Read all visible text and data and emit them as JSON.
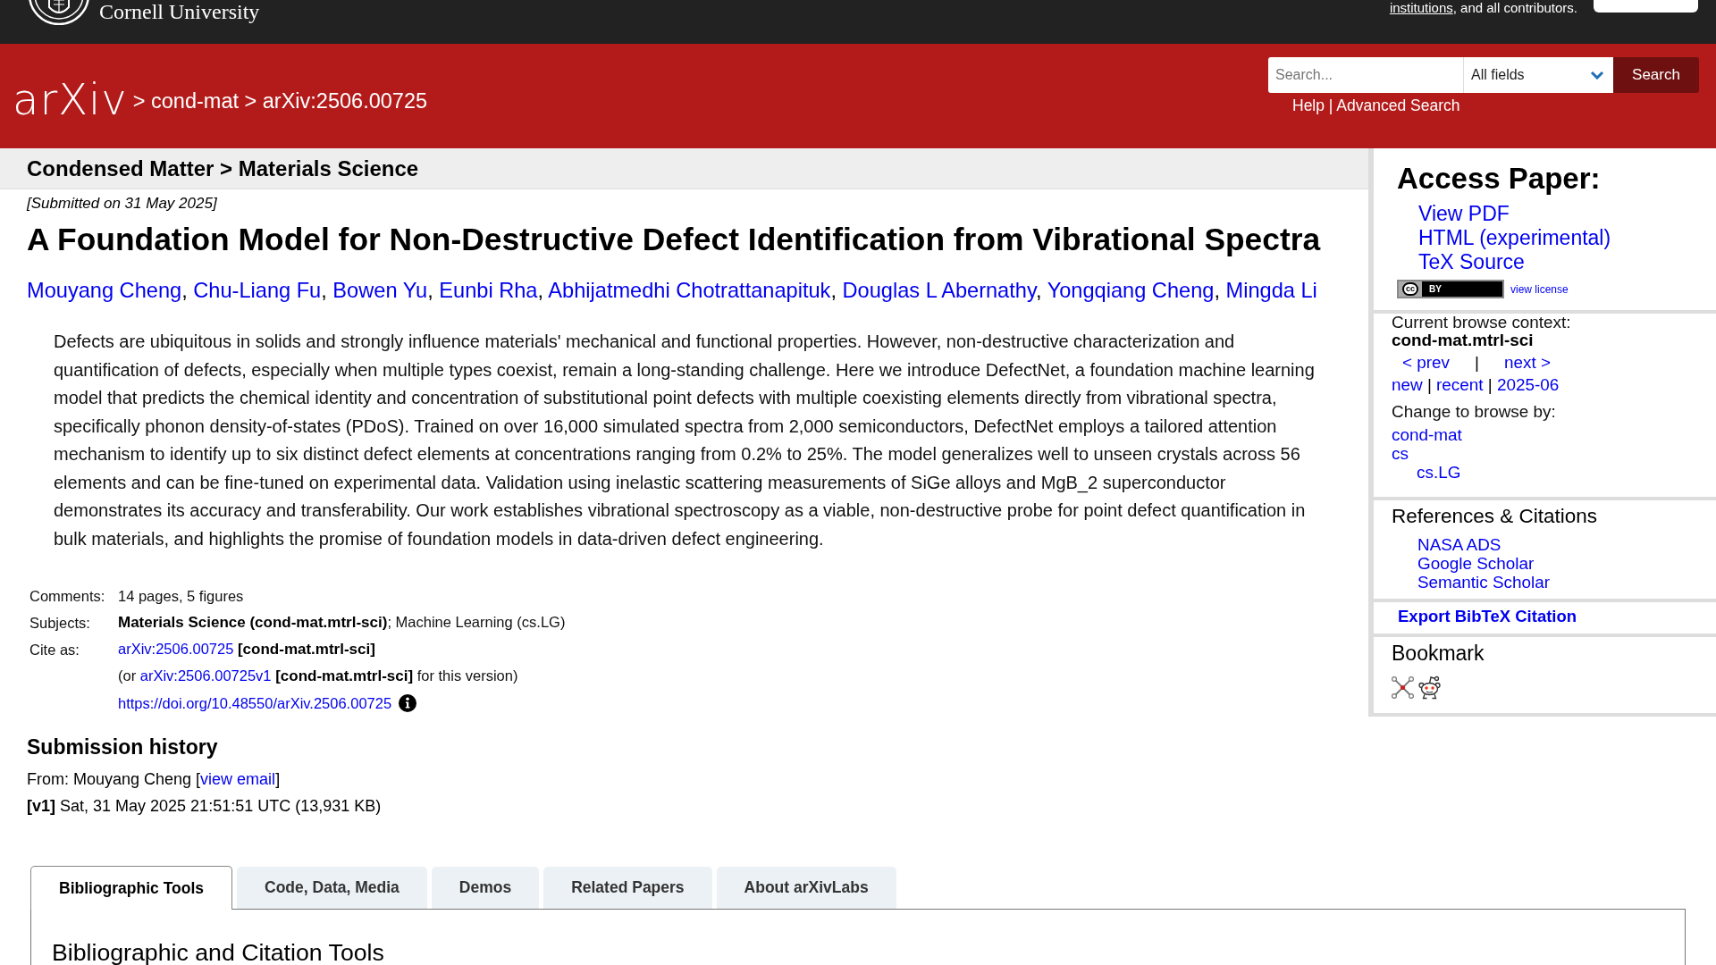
{
  "top_bar": {
    "logo_text": "Cornell University",
    "acknowledgment_link": "institutions",
    "acknowledgment_text": ", and all contributors."
  },
  "header": {
    "logo": "arXiv",
    "breadcrumbs": [
      {
        "separator": ">",
        "label": "cond-mat"
      },
      {
        "separator": ">",
        "label": "arXiv:2506.00725"
      }
    ],
    "search": {
      "placeholder": "Search...",
      "field": "All fields",
      "button": "Search",
      "links": [
        {
          "label": "Help",
          "separator": "|"
        },
        {
          "label": "Advanced Search"
        }
      ]
    }
  },
  "subheader": "Condensed Matter > Materials Science",
  "paper": {
    "dateline": "[Submitted on 31 May 2025]",
    "title": "A Foundation Model for Non-Destructive Defect Identification from Vibrational Spectra",
    "authors": [
      {
        "name": "Mouyang Cheng",
        "separator": ","
      },
      {
        "name": "Chu-Liang Fu",
        "separator": ","
      },
      {
        "name": "Bowen Yu",
        "separator": ","
      },
      {
        "name": "Eunbi Rha",
        "separator": ","
      },
      {
        "name": "Abhijatmedhi Chotrattanapituk",
        "separator": ","
      },
      {
        "name": "Douglas L Abernathy",
        "separator": ","
      },
      {
        "name": "Yongqiang Cheng",
        "separator": ","
      },
      {
        "name": "Mingda Li"
      }
    ],
    "abstract": "Defects are ubiquitous in solids and strongly influence materials' mechanical and functional properties. However, non-destructive characterization and quantification of defects, especially when multiple types coexist, remain a long-standing challenge. Here we introduce DefectNet, a foundation machine learning model that predicts the chemical identity and concentration of substitutional point defects with multiple coexisting elements directly from vibrational spectra, specifically phonon density-of-states (PDoS). Trained on over 16,000 simulated spectra from 2,000 semiconductors, DefectNet employs a tailored attention mechanism to identify up to six distinct defect elements at concentrations ranging from 0.2% to 25%. The model generalizes well to unseen crystals across 56 elements and can be fine-tuned on experimental data. Validation using inelastic scattering measurements of SiGe alloys and MgB_2 superconductor demonstrates its accuracy and transferability. Our work establishes vibrational spectroscopy as a viable, non-destructive probe for point defect quantification in bulk materials, and highlights the promise of foundation models in data-driven defect engineering.",
    "comments": {
      "label": "Comments:",
      "value": "14 pages, 5 figures"
    },
    "subjects": {
      "label": "Subjects:",
      "value": "**Materials Science (cond-mat.mtrl-sci)**; Machine Learning (cs.LG)"
    },
    "cite_as": {
      "label": "Cite as:",
      "id_link": "arXiv:2506.00725",
      "id_category": "[cond-mat.mtrl-sci]",
      "version_prefix": "(or",
      "version_link": "arXiv:2506.00725v1",
      "version_suffix": "**[cond-mat.mtrl-sci]** for this version)",
      "doi_link": "https://doi.org/10.48550/arXiv.2506.00725"
    }
  },
  "submission_history": {
    "heading": "Submission history",
    "from_prefix": "From: Mouyang Cheng [",
    "email_link": "view email",
    "from_suffix": "]",
    "versions": [
      "**[v1]** Sat, 31 May 2025 21:51:51 UTC (13,931 KB)"
    ]
  },
  "tabs": [
    {
      "label": "Bibliographic Tools",
      "selected": true
    },
    {
      "label": "Code, Data, Media",
      "selected": false
    },
    {
      "label": "Demos",
      "selected": false
    },
    {
      "label": "Related Papers",
      "selected": false
    },
    {
      "label": "About arXivLabs",
      "selected": false
    }
  ],
  "tab_panel": {
    "heading": "Bibliographic and Citation Tools"
  },
  "sidebar": {
    "access_paper": {
      "heading": "Access Paper:",
      "links": [
        "View PDF",
        "HTML (experimental)",
        "TeX Source"
      ],
      "license_badge": {
        "symbol": "cc",
        "terms": "BY"
      },
      "license_link": "view license"
    },
    "browse_context": {
      "label": "Current browse context:",
      "category": "cond-mat.mtrl-sci",
      "prev": "< prev",
      "divider": "|",
      "next": "next >",
      "listings": [
        {
          "label": "new",
          "separator": "|"
        },
        {
          "label": "recent",
          "separator": "|"
        },
        {
          "label": "2025-06"
        }
      ],
      "change_label": "Change to browse by:",
      "browse_by": [
        {
          "label": "cond-mat"
        },
        {
          "label": "cs",
          "children": [
            {
              "label": "cs.LG"
            }
          ]
        }
      ]
    },
    "references": {
      "heading": "References & Citations",
      "links": [
        "NASA ADS",
        "Google Scholar",
        "Semantic Scholar"
      ]
    },
    "export": "Export BibTeX Citation",
    "bookmark": {
      "heading": "Bookmark"
    }
  }
}
